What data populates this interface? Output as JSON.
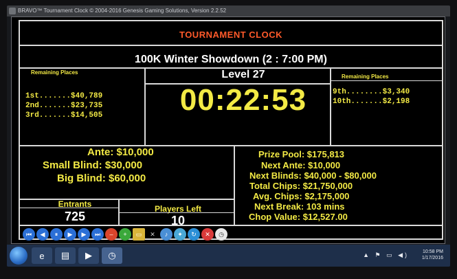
{
  "window": {
    "title": "BRAVO™ Tournament Clock © 2004-2016 Genesis Gaming Solutions, Version 2.2.52"
  },
  "header": {
    "app_title": "TOURNAMENT CLOCK",
    "event_name": "100K Winter Showdown (2 :  7:00 PM)"
  },
  "left_places": {
    "title": "Remaining Places",
    "rows": [
      "1st.......$40,789",
      "2nd.......$23,735",
      "3rd.......$14,505"
    ]
  },
  "right_places": {
    "title": "Remaining Places",
    "rows": [
      "9th........$3,340",
      "10th.......$2,198"
    ]
  },
  "clock": {
    "level": "Level 27",
    "time": "00:22:53"
  },
  "blinds": {
    "ante": "Ante: $10,000",
    "small": "Small Blind: $30,000",
    "big": "Big Blind: $60,000"
  },
  "info": {
    "prize_pool": "Prize Pool: $175,813",
    "next_ante": "Next Ante: $10,000",
    "next_blinds": "Next Blinds: $40,000 - $80,000",
    "total_chips": "Total Chips: $21,750,000",
    "avg_chips": "Avg. Chips: $2,175,000",
    "next_break": "Next Break: 103 mins",
    "chop_value": "Chop Value: $12,527.00"
  },
  "stats": {
    "entrants_label": "Entrants",
    "entrants_value": "725",
    "players_left_label": "Players Left",
    "players_left_value": "10"
  },
  "toolbar": {
    "buttons": [
      "first",
      "prev",
      "pause",
      "play",
      "next",
      "last",
      "stop",
      "add",
      "folder",
      "tools",
      "speaker",
      "star",
      "refresh",
      "close",
      "clock"
    ]
  },
  "taskbar": {
    "time": "10:58 PM",
    "date": "1/17/2016"
  },
  "colors": {
    "accent_title": "#ff5a2a",
    "timer": "#f3ea45",
    "label": "#f3ea45"
  }
}
